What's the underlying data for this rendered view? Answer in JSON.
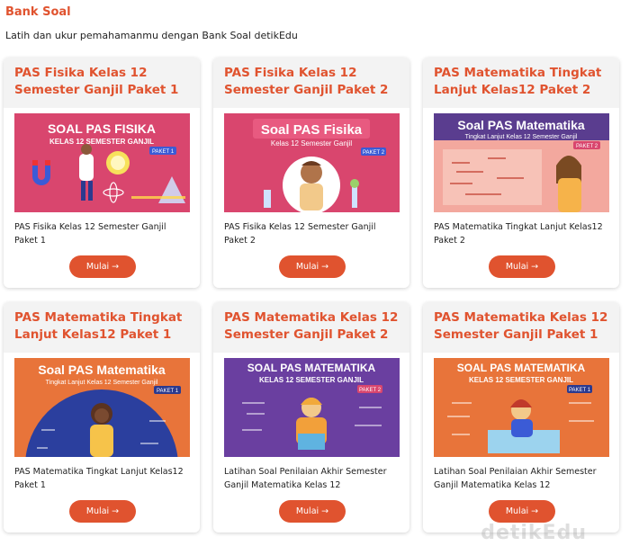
{
  "section": {
    "title": "Bank Soal",
    "subtitle": "Latih dan ukur pemahamanmu dengan Bank Soal detikEdu"
  },
  "cards": [
    {
      "title": "PAS Fisika Kelas 12 Semester Ganjil Paket 1",
      "thumb_title": "SOAL PAS FISIKA",
      "thumb_subtitle": "KELAS 12 SEMESTER GANJIL",
      "thumb_badge": "PAKET 1",
      "thumb_bg": "#d9466e",
      "description": "PAS Fisika Kelas 12 Semester Ganjil Paket 1",
      "button": "Mulai →"
    },
    {
      "title": "PAS Fisika Kelas 12 Semester Ganjil Paket 2",
      "thumb_title": "Soal PAS Fisika",
      "thumb_subtitle": "Kelas 12 Semester Ganjil",
      "thumb_badge": "PAKET 2",
      "thumb_bg": "#d9466e",
      "description": "PAS Fisika Kelas 12 Semester Ganjil Paket 2",
      "button": "Mulai →"
    },
    {
      "title": "PAS Matematika Tingkat Lanjut Kelas12 Paket 2",
      "thumb_title": "Soal PAS Matematika",
      "thumb_subtitle": "Tingkat Lanjut Kelas 12 Semester Ganjil",
      "thumb_badge": "PAKET 2",
      "thumb_bg": "#c94a6a",
      "description": "PAS Matematika Tingkat Lanjut Kelas12 Paket 2",
      "button": "Mulai →"
    },
    {
      "title": "PAS Matematika Tingkat Lanjut Kelas12 Paket 1",
      "thumb_title": "Soal PAS Matematika",
      "thumb_subtitle": "Tingkat Lanjut Kelas 12 Semester Ganjil",
      "thumb_badge": "PAKET 1",
      "thumb_bg": "#e8743a",
      "description": "PAS Matematika Tingkat Lanjut Kelas12 Paket 1",
      "button": "Mulai →"
    },
    {
      "title": "PAS Matematika Kelas 12 Semester Ganjil Paket 2",
      "thumb_title": "SOAL PAS MATEMATIKA",
      "thumb_subtitle": "KELAS 12 SEMESTER GANJIL",
      "thumb_badge": "PAKET 2",
      "thumb_bg": "#6a3fa0",
      "description": "Latihan Soal Penilaian Akhir Semester Ganjil Matematika Kelas 12",
      "button": "Mulai →"
    },
    {
      "title": "PAS Matematika Kelas 12 Semester Ganjil Paket 1",
      "thumb_title": "SOAL PAS MATEMATIKA",
      "thumb_subtitle": "KELAS 12 SEMESTER GANJIL",
      "thumb_badge": "PAKET 1",
      "thumb_bg": "#e8743a",
      "description": "Latihan Soal Penilaian Akhir Semester Ganjil Matematika Kelas 12",
      "button": "Mulai →"
    }
  ],
  "colors": {
    "accent": "#e0532f",
    "card_head_bg": "#f3f3f3"
  },
  "watermark": "detikEdu"
}
